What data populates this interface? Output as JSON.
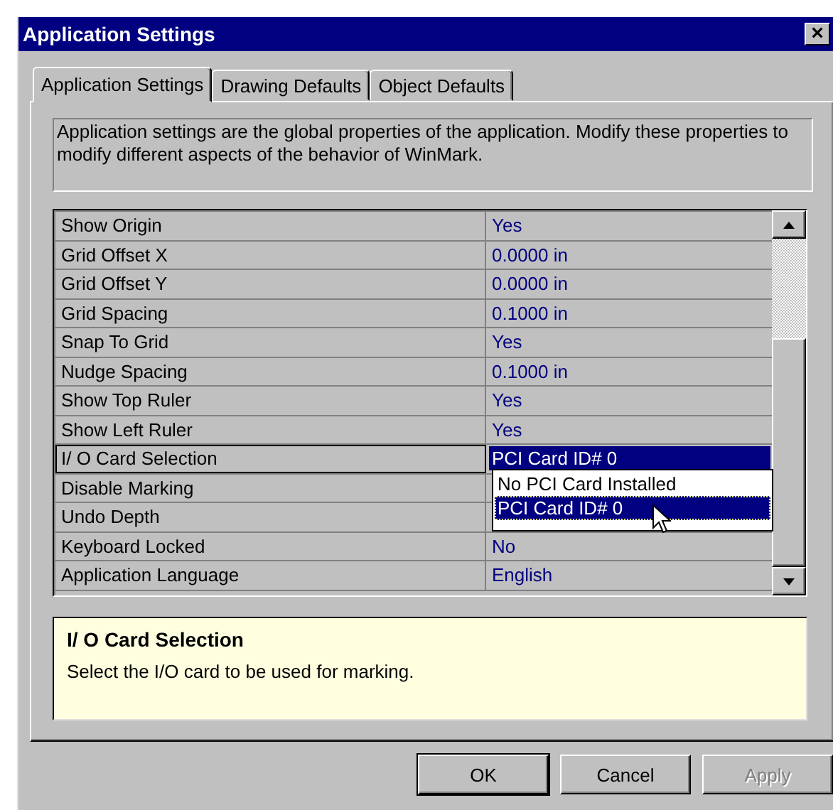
{
  "window": {
    "title": "Application Settings",
    "close": "×"
  },
  "tabs": [
    {
      "label": "Application Settings",
      "selected": true
    },
    {
      "label": "Drawing Defaults",
      "selected": false
    },
    {
      "label": "Object Defaults",
      "selected": false
    }
  ],
  "description": "Application settings are the global properties of the application. Modify these properties to modify different aspects of the behavior of WinMark.",
  "properties": [
    {
      "name": "Show Origin",
      "value": "Yes",
      "selected": false
    },
    {
      "name": "Grid Offset X",
      "value": "0.0000 in",
      "selected": false
    },
    {
      "name": "Grid Offset Y",
      "value": "0.0000 in",
      "selected": false
    },
    {
      "name": "Grid Spacing",
      "value": "0.1000 in",
      "selected": false
    },
    {
      "name": "Snap To Grid",
      "value": "Yes",
      "selected": false
    },
    {
      "name": "Nudge Spacing",
      "value": "0.1000 in",
      "selected": false
    },
    {
      "name": "Show Top Ruler",
      "value": "Yes",
      "selected": false
    },
    {
      "name": "Show Left Ruler",
      "value": "Yes",
      "selected": false
    },
    {
      "name": "I/ O Card Selection",
      "value": "PCI Card ID# 0",
      "selected": true
    },
    {
      "name": "Disable Marking",
      "selected": false
    },
    {
      "name": "Undo Depth",
      "selected": false
    },
    {
      "name": "Keyboard Locked",
      "value": "No",
      "selected": false
    },
    {
      "name": "Application Language",
      "value": "English",
      "selected": false
    }
  ],
  "dropdown": {
    "options": [
      {
        "label": "No PCI Card Installed",
        "selected": false
      },
      {
        "label": "PCI Card ID# 0",
        "selected": true
      }
    ]
  },
  "help": {
    "title": "I/ O Card Selection",
    "text": "Select the I/O card to be used for marking."
  },
  "buttons": [
    {
      "label": "OK",
      "disabled": false,
      "default": true
    },
    {
      "label": "Cancel",
      "disabled": false,
      "default": false
    },
    {
      "label": "Apply",
      "disabled": true,
      "default": false
    }
  ]
}
